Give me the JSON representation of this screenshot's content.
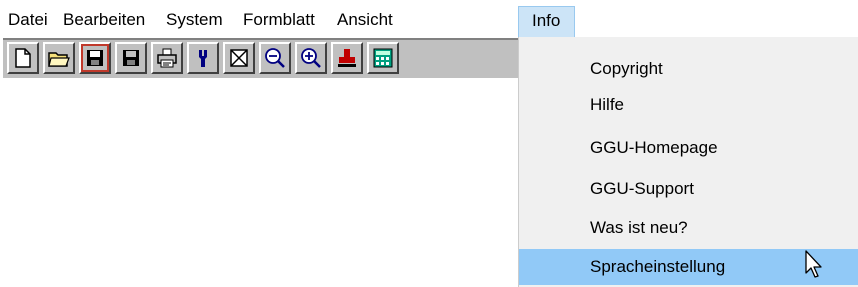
{
  "menubar": {
    "items": [
      {
        "label": "Datei"
      },
      {
        "label": "Bearbeiten"
      },
      {
        "label": "System"
      },
      {
        "label": "Formblatt"
      },
      {
        "label": "Ansicht"
      },
      {
        "label": "Info"
      }
    ],
    "active": "Info"
  },
  "toolbar": {
    "buttons": [
      {
        "icon": "new-document-icon"
      },
      {
        "icon": "open-folder-icon"
      },
      {
        "icon": "save-icon"
      },
      {
        "icon": "save-as-icon"
      },
      {
        "icon": "print-icon"
      },
      {
        "icon": "tool-icon"
      },
      {
        "icon": "crossed-page-icon"
      },
      {
        "icon": "zoom-out-icon"
      },
      {
        "icon": "zoom-in-icon"
      },
      {
        "icon": "stamp-icon"
      },
      {
        "icon": "calculator-icon"
      }
    ]
  },
  "dropdown": {
    "items": [
      {
        "label": "Copyright"
      },
      {
        "label": "Hilfe"
      },
      {
        "label": "GGU-Homepage"
      },
      {
        "label": "GGU-Support"
      },
      {
        "label": "Was ist neu?"
      },
      {
        "label": "Spracheinstellung"
      }
    ],
    "selected": "Spracheinstellung"
  },
  "colors": {
    "menu_active_bg": "#cce4f7",
    "dropdown_bg": "#f0f0f0",
    "selected_bg": "#91c9f7",
    "toolbar_bg": "#c0c0c0"
  }
}
